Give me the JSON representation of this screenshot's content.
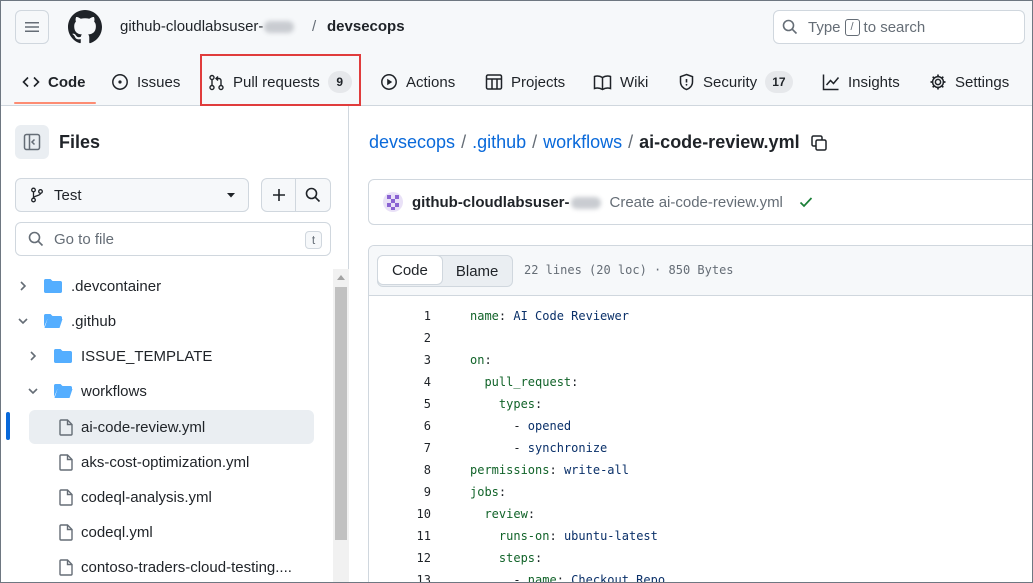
{
  "header": {
    "owner": "github-cloudlabsuser-",
    "separator": "/",
    "repo": "devsecops",
    "search": {
      "label_before": "Type",
      "kbd": "/",
      "label_after": "to search"
    }
  },
  "tabs": [
    {
      "label": "Code",
      "selected": true
    },
    {
      "label": "Issues"
    },
    {
      "label": "Pull requests",
      "count": "9",
      "highlighted": true
    },
    {
      "label": "Actions"
    },
    {
      "label": "Projects"
    },
    {
      "label": "Wiki"
    },
    {
      "label": "Security",
      "count": "17"
    },
    {
      "label": "Insights"
    },
    {
      "label": "Settings"
    }
  ],
  "sidebar": {
    "title": "Files",
    "branch": "Test",
    "goto_placeholder": "Go to file",
    "goto_kbd": "t",
    "tree": [
      {
        "name": ".devcontainer",
        "type": "folder",
        "expanded": false
      },
      {
        "name": ".github",
        "type": "folder",
        "expanded": true
      },
      {
        "name": "ISSUE_TEMPLATE",
        "type": "folder",
        "expanded": false
      },
      {
        "name": "workflows",
        "type": "folder",
        "expanded": true
      },
      {
        "name": "ai-code-review.yml",
        "type": "file",
        "selected": true
      },
      {
        "name": "aks-cost-optimization.yml",
        "type": "file"
      },
      {
        "name": "codeql-analysis.yml",
        "type": "file"
      },
      {
        "name": "codeql.yml",
        "type": "file"
      },
      {
        "name": "contoso-traders-cloud-testing....",
        "type": "file"
      }
    ]
  },
  "main": {
    "path": [
      {
        "label": "devsecops",
        "link": true
      },
      {
        "label": ".github",
        "link": true
      },
      {
        "label": "workflows",
        "link": true
      },
      {
        "label": "ai-code-review.yml",
        "link": false
      }
    ],
    "path_sep": "/",
    "commit": {
      "author": "github-cloudlabsuser-",
      "message": "Create ai-code-review.yml",
      "status": "success"
    },
    "viewer": {
      "tab_code": "Code",
      "tab_blame": "Blame",
      "meta": "22 lines (20 loc) · 850 Bytes"
    },
    "code_lines": [
      {
        "n": "1",
        "text": "name: AI Code Reviewer"
      },
      {
        "n": "2",
        "text": ""
      },
      {
        "n": "3",
        "text": "on:"
      },
      {
        "n": "4",
        "text": "  pull_request:"
      },
      {
        "n": "5",
        "text": "    types:"
      },
      {
        "n": "6",
        "text": "      - opened"
      },
      {
        "n": "7",
        "text": "      - synchronize"
      },
      {
        "n": "8",
        "text": "permissions: write-all"
      },
      {
        "n": "9",
        "text": "jobs:"
      },
      {
        "n": "10",
        "text": "  review:"
      },
      {
        "n": "11",
        "text": "    runs-on: ubuntu-latest"
      },
      {
        "n": "12",
        "text": "    steps:"
      },
      {
        "n": "13",
        "text": "      - name: Checkout Repo"
      }
    ]
  },
  "colors": {
    "accent_underline": "#fd8c73",
    "link": "#0969da",
    "highlight_box": "#e03c3c",
    "success": "#1a7f37"
  }
}
